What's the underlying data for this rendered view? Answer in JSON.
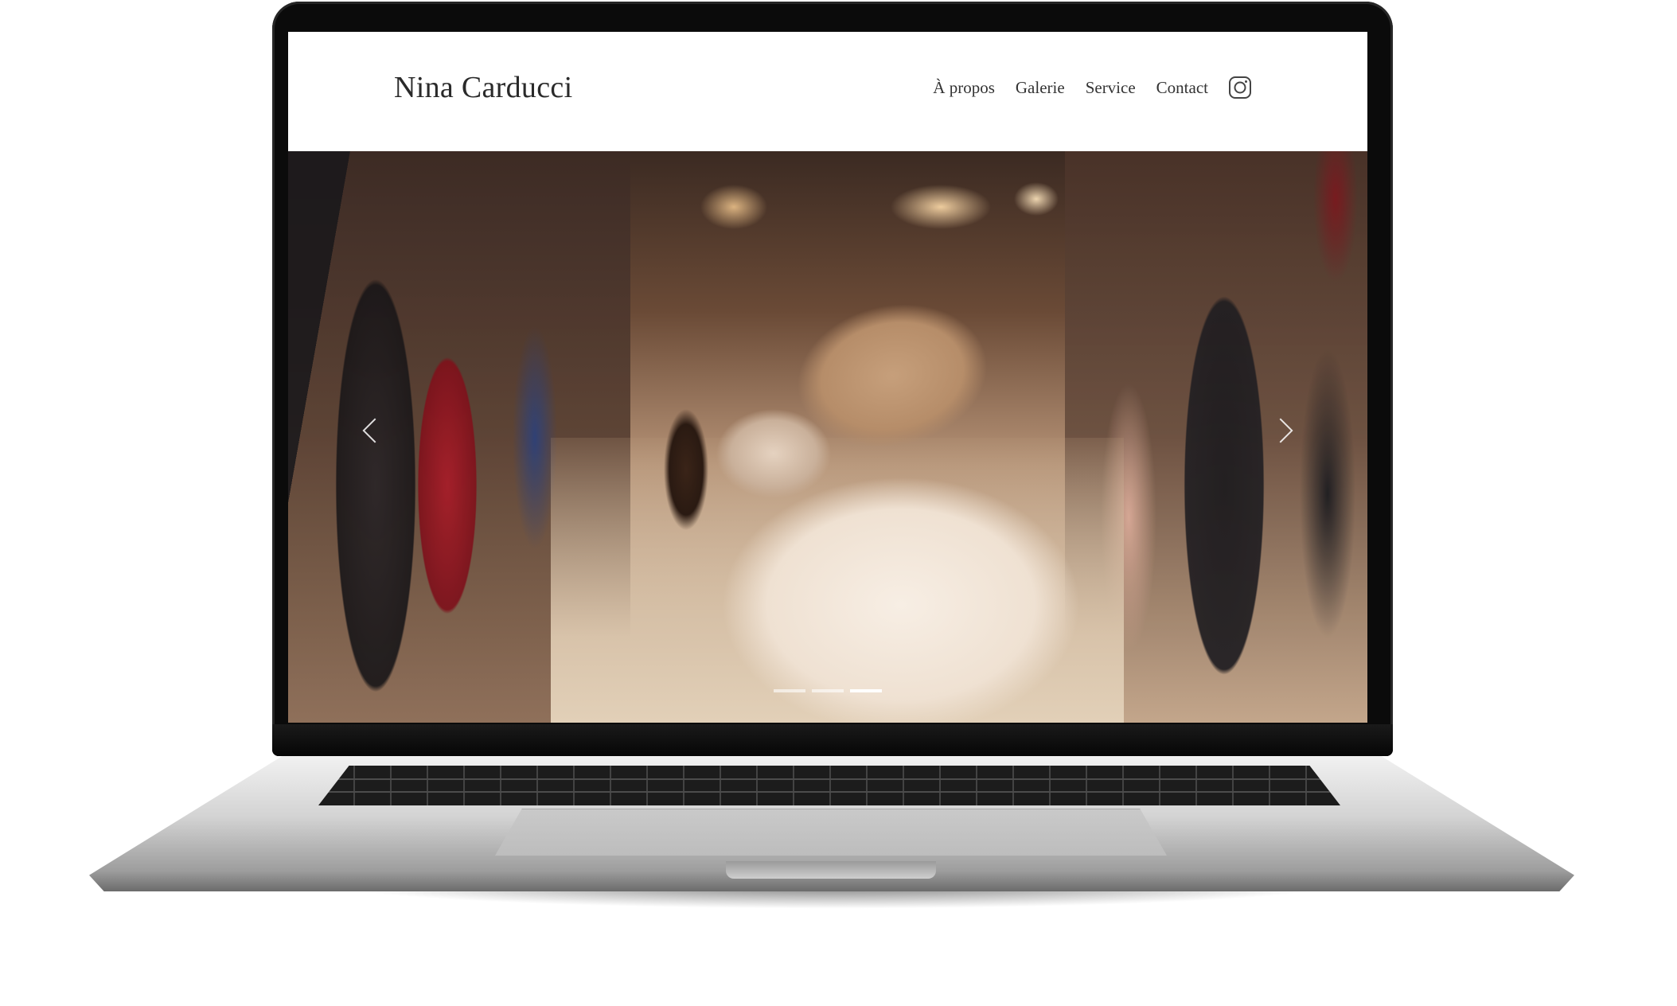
{
  "site": {
    "brand": "Nina Carducci",
    "nav": [
      {
        "label": "À propos"
      },
      {
        "label": "Galerie"
      },
      {
        "label": "Service"
      },
      {
        "label": "Contact"
      }
    ],
    "social_icon": "instagram-icon"
  },
  "hero": {
    "slide_count": 3,
    "active_slide": 3,
    "prev_icon": "chevron-left-icon",
    "next_icon": "chevron-right-icon"
  },
  "colors": {
    "text": "#2a2a2a",
    "header_bg": "#ffffff",
    "indicator_active": "#ffffff"
  }
}
